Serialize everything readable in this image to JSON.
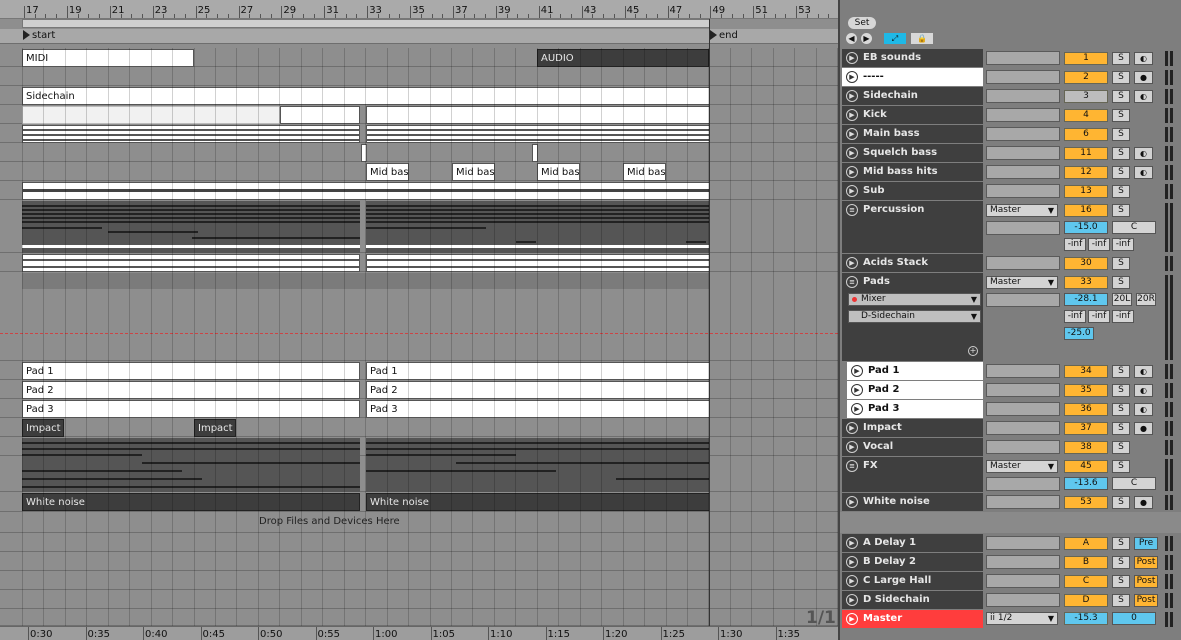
{
  "ruler": {
    "bars": [
      "17",
      "19",
      "21",
      "23",
      "25",
      "27",
      "29",
      "31",
      "33",
      "35",
      "37",
      "39",
      "41",
      "43",
      "45",
      "47",
      "49",
      "51",
      "53"
    ]
  },
  "locators": {
    "start": "start",
    "end": "end"
  },
  "clips": {
    "midi": "MIDI",
    "audio": "AUDIO",
    "sidechain": "Sidechain",
    "mid_bass_1": "Mid bass",
    "mid_bass_2": "Mid bass",
    "mid_bass_3": "Mid bass",
    "mid_bass_4": "Mid bass",
    "pad1_a": "Pad 1",
    "pad1_b": "Pad 1",
    "pad2_a": "Pad 2",
    "pad2_b": "Pad 2",
    "pad3_a": "Pad 3",
    "pad3_b": "Pad 3",
    "impact_a": "Impact",
    "impact_b": "Impact",
    "white_noise_a": "White noise",
    "white_noise_b": "White noise"
  },
  "drop_zone": "Drop Files and Devices Here",
  "zoom_indicator": "1/1",
  "time_ruler": [
    "0:30",
    "0:35",
    "0:40",
    "0:45",
    "0:50",
    "0:55",
    "1:00",
    "1:05",
    "1:10",
    "1:15",
    "1:20",
    "1:25",
    "1:30",
    "1:35"
  ],
  "mixer": {
    "set_label": "Set",
    "tracks": [
      {
        "name": "EB sounds",
        "num": "1",
        "s": "S"
      },
      {
        "name": "-----",
        "num": "2",
        "s": "S"
      },
      {
        "name": "Sidechain",
        "num": "3",
        "s": "S"
      },
      {
        "name": "Kick",
        "num": "4",
        "s": "S"
      },
      {
        "name": "Main bass",
        "num": "6",
        "s": "S"
      },
      {
        "name": "Squelch bass",
        "num": "11",
        "s": "S"
      },
      {
        "name": "Mid bass hits",
        "num": "12",
        "s": "S"
      },
      {
        "name": "Sub",
        "num": "13",
        "s": "S"
      },
      {
        "name": "Percussion",
        "num": "16",
        "s": "S",
        "output": "Master",
        "volume": "-15.0",
        "pan": "C",
        "sends": [
          "-inf",
          "-inf",
          "-inf"
        ]
      },
      {
        "name": "Acids Stack",
        "num": "30",
        "s": "S"
      },
      {
        "name": "Pads",
        "num": "33",
        "s": "S",
        "output": "Master",
        "volume": "-28.1",
        "pan_l": "20L",
        "pan_r": "20R",
        "sends": [
          "-inf",
          "-inf",
          "-inf"
        ],
        "extra": "-25.0",
        "devices": [
          "Mixer",
          "D-Sidechain"
        ]
      },
      {
        "name": "Pad 1",
        "num": "34",
        "s": "S"
      },
      {
        "name": "Pad 2",
        "num": "35",
        "s": "S"
      },
      {
        "name": "Pad 3",
        "num": "36",
        "s": "S"
      },
      {
        "name": "Impact",
        "num": "37",
        "s": "S"
      },
      {
        "name": "Vocal",
        "num": "38",
        "s": "S"
      },
      {
        "name": "FX",
        "num": "45",
        "s": "S",
        "output": "Master",
        "volume": "-13.6",
        "pan": "C"
      },
      {
        "name": "White noise",
        "num": "53",
        "s": "S"
      }
    ],
    "returns": [
      {
        "name": "A Delay 1",
        "letter": "A",
        "s": "S",
        "mode": "Pre"
      },
      {
        "name": "B Delay 2",
        "letter": "B",
        "s": "S",
        "mode": "Post"
      },
      {
        "name": "C Large Hall",
        "letter": "C",
        "s": "S",
        "mode": "Post"
      },
      {
        "name": "D Sidechain",
        "letter": "D",
        "s": "S",
        "mode": "Post"
      }
    ],
    "master": {
      "name": "Master",
      "input": "ii 1/2",
      "volume": "-15.3",
      "pan": "0"
    }
  }
}
